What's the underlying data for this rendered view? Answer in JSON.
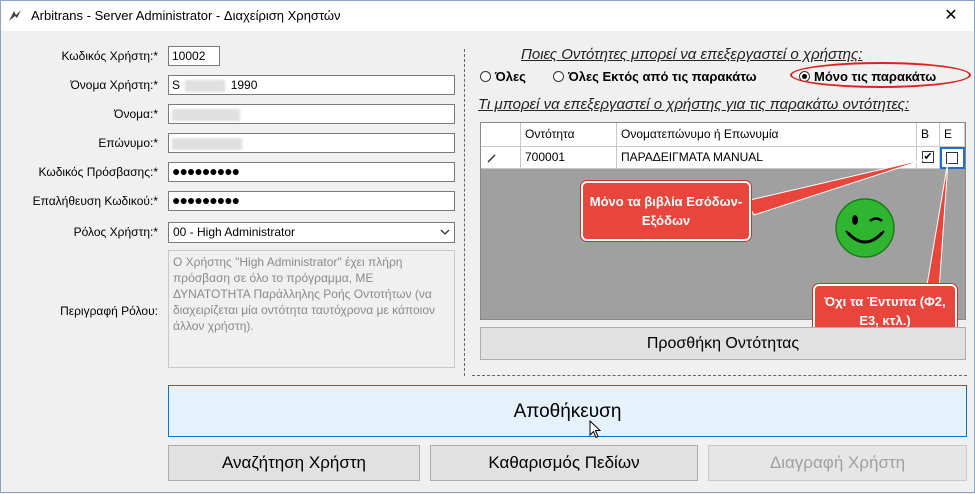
{
  "window": {
    "title": "Arbitrans - Server Administrator - Διαχείριση Χρηστών",
    "close_glyph": "✕"
  },
  "form": {
    "labels": {
      "user_code": "Κωδικός Χρήστη:*",
      "username": "Όνομα Χρήστη:*",
      "first_name": "Όνομα:*",
      "last_name": "Επώνυμο:*",
      "password": "Κωδικός Πρόσβασης:*",
      "password_confirm": "Επαλήθευση Κωδικού:*",
      "role": "Ρόλος Χρήστη:*",
      "role_description": "Περιγραφή Ρόλου:"
    },
    "values": {
      "user_code": "10002",
      "username_prefix": "S",
      "username_suffix": "1990",
      "password": "●●●●●●●●●",
      "password_confirm": "●●●●●●●●●",
      "role": "00 - High Administrator"
    },
    "role_description": "Ο Χρήστης \"High Administrator\" έχει πλήρη πρόσβαση σε όλο το πρόγραμμα, ΜΕ ΔΥΝΑΤΟΤΗΤΑ Παράλληλης Ροής Οντοτήτων (να διαχειρίζεται μία οντότητα ταυτόχρονα με κάποιον άλλον χρήστη)."
  },
  "entities": {
    "question": "Ποιες Οντότητες μπορεί να επεξεργαστεί ο χρήστης:",
    "options": [
      "Όλες",
      "Όλες Εκτός από τις παρακάτω",
      "Μόνο τις παρακάτω"
    ],
    "selected_index": 2,
    "grid_title": "Τι μπορεί να επεξεργαστεί ο χρήστης για τις παρακάτω οντότητες:",
    "columns": {
      "entity": "Οντότητα",
      "name": "Ονοματεπώνυμο ή Επωνυμία",
      "b": "Β",
      "e": "Ε"
    },
    "rows": [
      {
        "entity": "700001",
        "name": "ΠΑΡΑΔΕΙΓΜΑΤΑ MANUAL",
        "b_checked": true,
        "e_checked": false
      }
    ],
    "add_button": "Προσθήκη Οντότητας"
  },
  "callouts": {
    "books": "Μόνο τα βιβλία Εσόδων-Εξόδων",
    "forms": "Όχι τα Έντυπα (Φ2, Ε3, κτλ.)"
  },
  "buttons": {
    "save": "Αποθήκευση",
    "search": "Αναζήτηση Χρήστη",
    "clear": "Καθαρισμός Πεδίων",
    "delete": "Διαγραφή Χρήστη"
  },
  "colors": {
    "callout": "#e8463c",
    "smiley": "#2fb52f",
    "highlight": "#e02020"
  }
}
